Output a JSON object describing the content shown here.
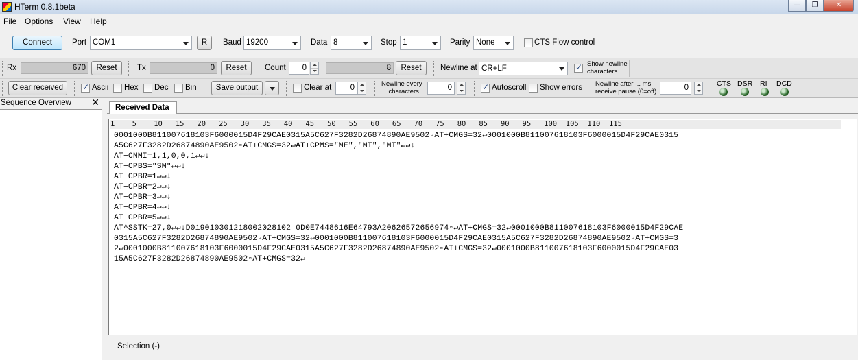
{
  "window": {
    "title": "HTerm 0.8.1beta",
    "min": "—",
    "max": "❐",
    "close": "✕"
  },
  "menu": [
    "File",
    "Options",
    "View",
    "Help"
  ],
  "conn": {
    "connect_label": "Connect",
    "port_label": "Port",
    "port_value": "COM1",
    "r_label": "R",
    "baud_label": "Baud",
    "baud_value": "19200",
    "data_label": "Data",
    "data_value": "8",
    "stop_label": "Stop",
    "stop_value": "1",
    "parity_label": "Parity",
    "parity_value": "None",
    "cts_label": "CTS Flow control",
    "cts_checked": false
  },
  "counters": {
    "rx_label": "Rx",
    "rx_value": "670",
    "rx_reset": "Reset",
    "tx_label": "Tx",
    "tx_value": "0",
    "tx_reset": "Reset",
    "count_label": "Count",
    "count_value": "0",
    "count_bar": "8",
    "count_reset": "Reset",
    "newline_at_label": "Newline at",
    "newline_at_value": "CR+LF",
    "show_newline_label_1": "Show newline",
    "show_newline_label_2": "characters",
    "show_newline_checked": true
  },
  "display": {
    "clear_received": "Clear received",
    "ascii": "Ascii",
    "ascii_checked": true,
    "hex": "Hex",
    "hex_checked": false,
    "dec": "Dec",
    "dec_checked": false,
    "bin": "Bin",
    "bin_checked": false,
    "save_output": "Save output",
    "clear_at": "Clear at",
    "clear_at_value": "0",
    "newline_every_1": "Newline every",
    "newline_every_2": "... characters",
    "newline_every_value": "0",
    "autoscroll": "Autoscroll",
    "autoscroll_checked": true,
    "show_errors": "Show errors",
    "show_errors_checked": false,
    "newline_after_1": "Newline after ... ms",
    "newline_after_2": "receive pause (0=off)",
    "newline_after_value": "0",
    "signals": [
      "CTS",
      "DSR",
      "RI",
      "DCD"
    ]
  },
  "sequence": {
    "title": "Sequence Overview",
    "close": "✕"
  },
  "received": {
    "tab": "Received Data",
    "ruler": "1    5    10   15   20   25   30   35   40   45   50   55   60   65   70   75   80   85   90   95   100  105  110  115",
    "lines": [
      "0001000B811007618103F6000015D4F29CAE0315A5C627F3282D26874890AE9502▫AT+CMGS=32↵0001000B811007618103F6000015D4F29CAE0315",
      "A5C627F3282D26874890AE9502▫AT+CMGS=32↵AT+CPMS=\"ME\",\"MT\",\"MT\"↵↵↓",
      "AT+CNMI=1,1,0,0,1↵↵↓",
      "AT+CPBS=\"SM\"↵↵↓",
      "AT+CPBR=1↵↵↓",
      "AT+CPBR=2↵↵↓",
      "AT+CPBR=3↵↵↓",
      "AT+CPBR=4↵↵↓",
      "AT+CPBR=5↵↵↓",
      "AT^SSTK=27,0↵↵↓D019010301218002028102 0D0E7448616E64793A20626572656974▫↵AT+CMGS=32↵0001000B811007618103F6000015D4F29CAE",
      "0315A5C627F3282D26874890AE9502▫AT+CMGS=32↵0001000B811007618103F6000015D4F29CAE0315A5C627F3282D26874890AE9502▫AT+CMGS=3",
      "2↵0001000B811007618103F6000015D4F29CAE0315A5C627F3282D26874890AE9502▫AT+CMGS=32↵0001000B811007618103F6000015D4F29CAE03",
      "15A5C627F3282D26874890AE9502▫AT+CMGS=32↵"
    ],
    "selection": "Selection (-)"
  }
}
